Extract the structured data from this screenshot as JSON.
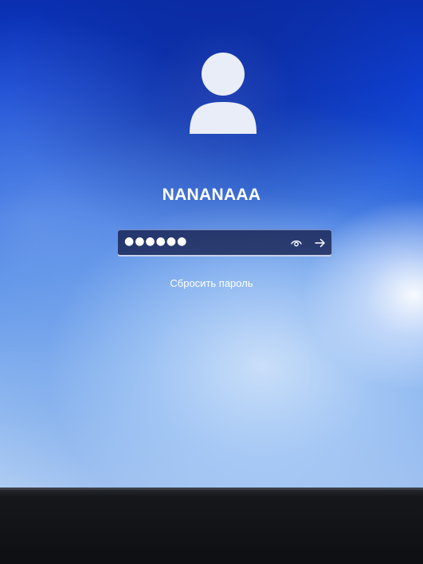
{
  "user": {
    "name": "NANANAAA"
  },
  "password_field": {
    "masked_value": "●●●●●●"
  },
  "links": {
    "reset_password": "Сбросить пароль"
  },
  "icons": {
    "avatar": "user-silhouette-icon",
    "reveal": "eye-icon",
    "submit": "arrow-right-icon"
  },
  "colors": {
    "accent_blue": "#0f3fcf",
    "text": "#ffffff"
  }
}
